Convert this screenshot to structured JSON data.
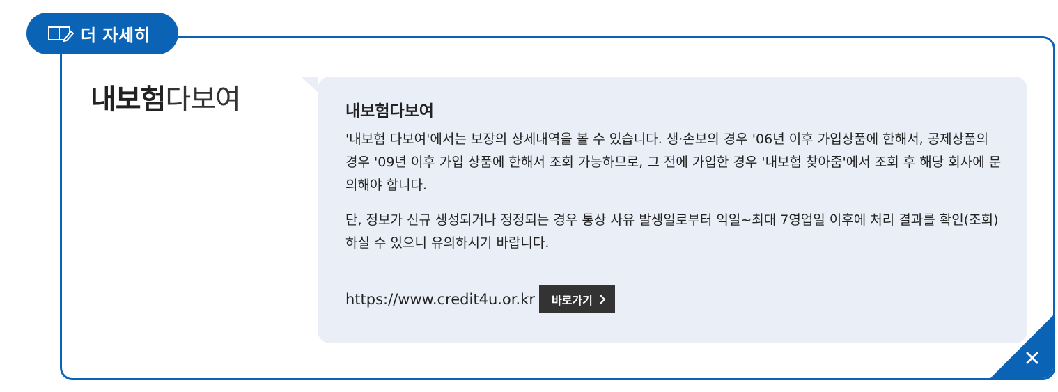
{
  "tab": {
    "label": "더 자세히",
    "icon": "book-icon"
  },
  "service": {
    "title_bold": "내보험",
    "title_light": "다보여"
  },
  "info": {
    "heading": "내보험다보여",
    "paragraph1": "'내보험 다보여'에서는 보장의 상세내역을 볼 수 있습니다. 생·손보의 경우 '06년 이후 가입상품에 한해서, 공제상품의 경우 '09년 이후 가입 상품에 한해서 조회 가능하므로, 그 전에 가입한 경우 '내보험 찾아줌'에서 조회 후 해당 회사에 문의해야 합니다.",
    "paragraph2": "단, 정보가 신규 생성되거나 정정되는 경우 통상 사유 발생일로부터 익일~최대 7영업일 이후에 처리 결과를 확인(조회) 하실 수 있으니 유의하시기 바랍니다.",
    "url": "https://www.credit4u.or.kr",
    "go_label": "바로가기"
  },
  "colors": {
    "accent": "#0a63b5",
    "box_bg": "#e9eef7",
    "button_bg": "#333333"
  }
}
